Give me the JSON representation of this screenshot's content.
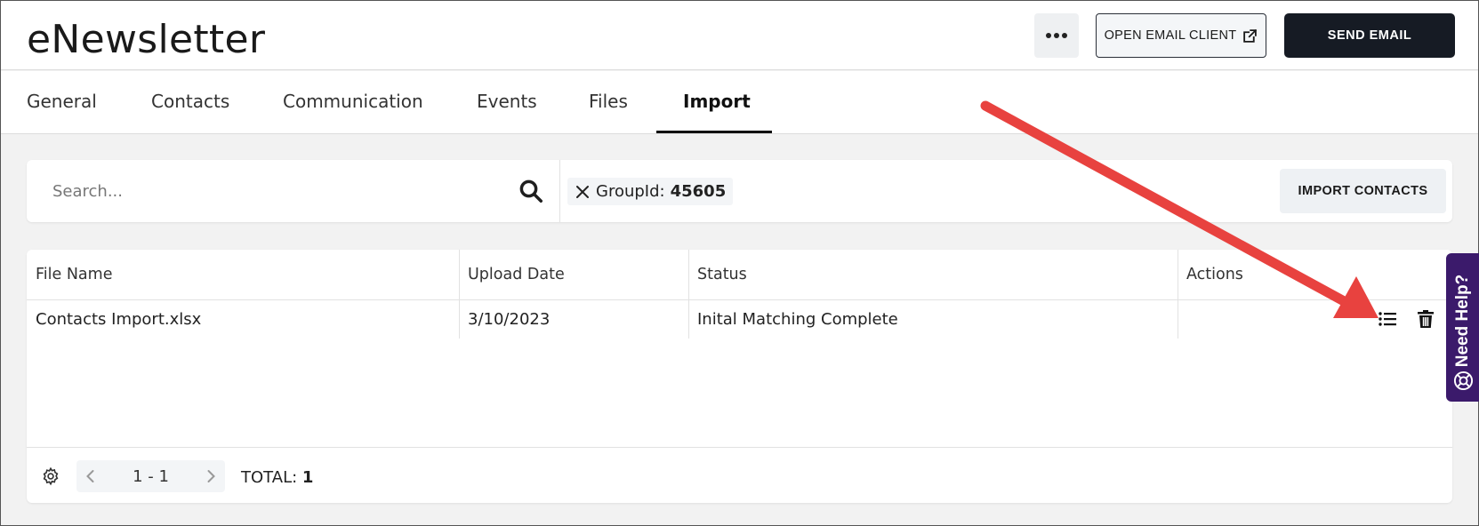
{
  "header": {
    "app_title": "eNewsletter",
    "more_icon": "more-horizontal-icon",
    "open_email_label": "OPEN EMAIL CLIENT",
    "open_email_icon": "external-link-icon",
    "send_email_label": "SEND EMAIL"
  },
  "tabs": [
    {
      "label": "General",
      "active": false
    },
    {
      "label": "Contacts",
      "active": false
    },
    {
      "label": "Communication",
      "active": false
    },
    {
      "label": "Events",
      "active": false
    },
    {
      "label": "Files",
      "active": false
    },
    {
      "label": "Import",
      "active": true
    }
  ],
  "filter": {
    "search_placeholder": "Search...",
    "search_icon": "search-icon",
    "chip_key": "GroupId:",
    "chip_value": "45605",
    "chip_close_icon": "close-icon",
    "import_label": "IMPORT CONTACTS"
  },
  "table": {
    "columns": [
      "File Name",
      "Upload Date",
      "Status",
      "Actions"
    ],
    "rows": [
      {
        "file_name": "Contacts Import.xlsx",
        "upload_date": "3/10/2023",
        "status": "Inital Matching Complete",
        "actions": [
          "list-details-icon",
          "trash-icon"
        ]
      }
    ]
  },
  "footer": {
    "settings_icon": "gear-icon",
    "page_range": "1 - 1",
    "total_label": "TOTAL:",
    "total_value": "1"
  },
  "help_tab": {
    "label": "Need Help?",
    "icon": "lifebuoy-icon",
    "color": "#3b1a6b"
  },
  "colors": {
    "primary_dark": "#161b24",
    "annotation_arrow": "#e8423f"
  }
}
